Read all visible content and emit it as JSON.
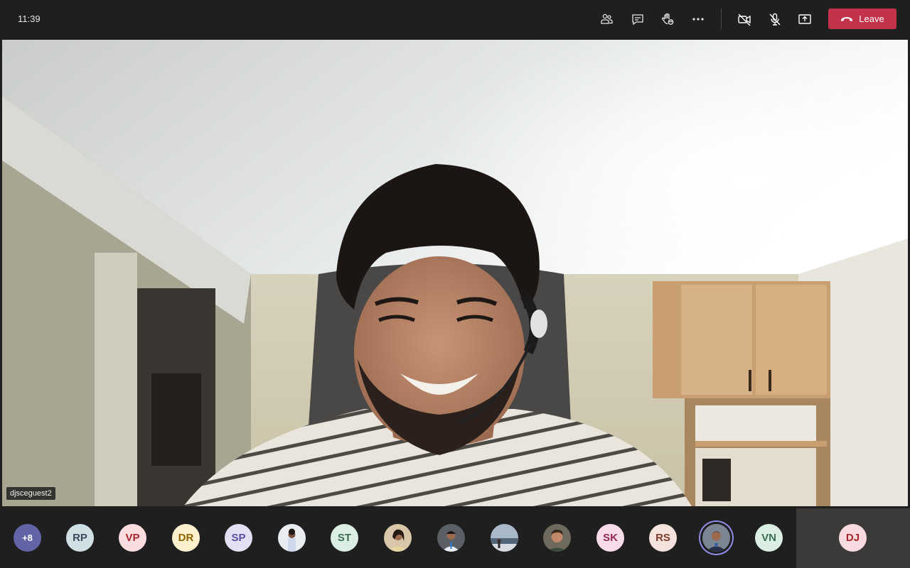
{
  "topbar": {
    "time": "11:39",
    "buttons": [
      {
        "name": "people-icon"
      },
      {
        "name": "chat-icon"
      },
      {
        "name": "raise-hand-icon"
      },
      {
        "name": "more-options-icon"
      },
      {
        "name": "camera-off-icon"
      },
      {
        "name": "mic-muted-icon"
      },
      {
        "name": "share-screen-icon"
      }
    ],
    "leave_label": "Leave",
    "leave_color": "#c4314b"
  },
  "stage": {
    "participant_name": "djsceguest2"
  },
  "participants": {
    "overflow": {
      "label": "+8",
      "bg": "#6264a7",
      "fg": "#ffffff"
    },
    "list": [
      {
        "initials": "RP",
        "bg": "#cfe1e4",
        "fg": "#3a4a58"
      },
      {
        "initials": "VP",
        "bg": "#fbdde0",
        "fg": "#a4262c"
      },
      {
        "initials": "DR",
        "bg": "#fdf0cc",
        "fg": "#8a6400"
      },
      {
        "initials": "SP",
        "bg": "#e4e0f4",
        "fg": "#5c4fa0"
      },
      {
        "initials": "",
        "photo": true
      },
      {
        "initials": "ST",
        "bg": "#daeee3",
        "fg": "#3e6d52"
      },
      {
        "initials": "",
        "photo": true
      },
      {
        "initials": "",
        "photo": true
      },
      {
        "initials": "",
        "photo": true
      },
      {
        "initials": "",
        "photo": true
      },
      {
        "initials": "SK",
        "bg": "#f7dbe8",
        "fg": "#8f2a5a"
      },
      {
        "initials": "RS",
        "bg": "#f3e3dc",
        "fg": "#7a3b2a"
      },
      {
        "initials": "",
        "photo": true,
        "active": true
      },
      {
        "initials": "VN",
        "bg": "#daeee3",
        "fg": "#3e6d52"
      }
    ],
    "self": {
      "initials": "DJ",
      "bg": "#f7dbe0",
      "fg": "#a4262c"
    }
  }
}
